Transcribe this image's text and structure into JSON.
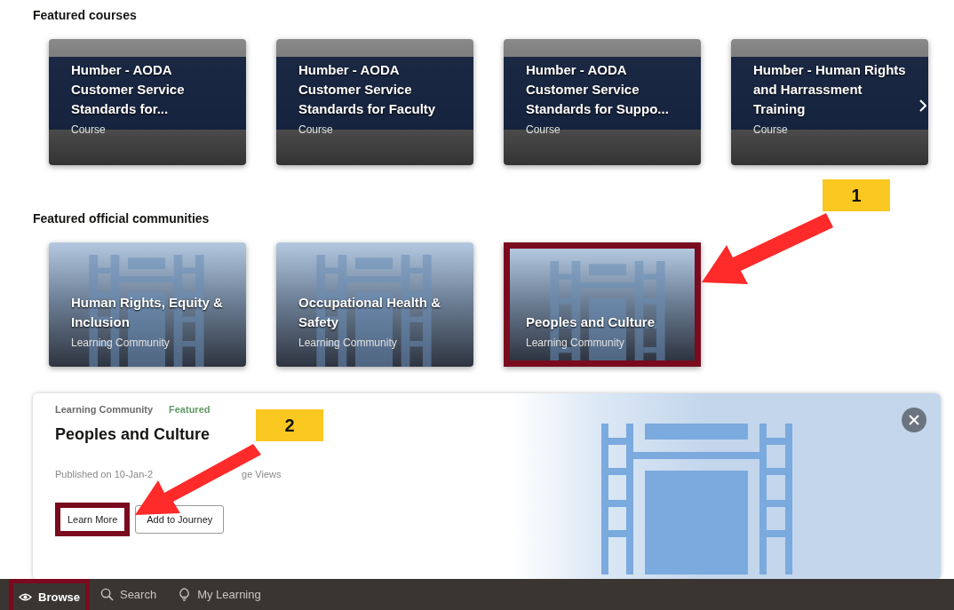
{
  "featured_courses": {
    "heading": "Featured courses",
    "items": [
      {
        "title": "Humber - AODA Customer Service Standards for...",
        "type": "Course"
      },
      {
        "title": "Humber - AODA Customer Service Standards for Faculty",
        "type": "Course"
      },
      {
        "title": "Humber - AODA Customer Service Standards for Suppo...",
        "type": "Course"
      },
      {
        "title": "Humber - Human Rights and Harrassment Training",
        "type": "Course"
      }
    ]
  },
  "featured_communities": {
    "heading": "Featured official communities",
    "items": [
      {
        "title": "Human Rights, Equity & Inclusion",
        "type": "Learning Community",
        "highlighted": false
      },
      {
        "title": "Occupational Health & Safety",
        "type": "Learning Community",
        "highlighted": false
      },
      {
        "title": "Peoples and Culture",
        "type": "Learning Community",
        "highlighted": true
      }
    ]
  },
  "detail": {
    "type": "Learning Community",
    "badge": "Featured",
    "title": "Peoples and Culture",
    "meta": [
      "Published on 10-Jan-2",
      "ge Views"
    ],
    "buttons": [
      {
        "label": "Learn More",
        "highlighted": true
      },
      {
        "label": "Add to Journey",
        "highlighted": false
      }
    ]
  },
  "nav": [
    {
      "label": "Browse",
      "kind": "eye",
      "selected": true,
      "highlighted": true
    },
    {
      "label": "Search",
      "kind": "search",
      "selected": false,
      "highlighted": false
    },
    {
      "label": "My Learning",
      "kind": "bulb",
      "selected": false,
      "highlighted": false
    }
  ],
  "callouts": [
    {
      "number": "1"
    },
    {
      "number": "2"
    }
  ]
}
